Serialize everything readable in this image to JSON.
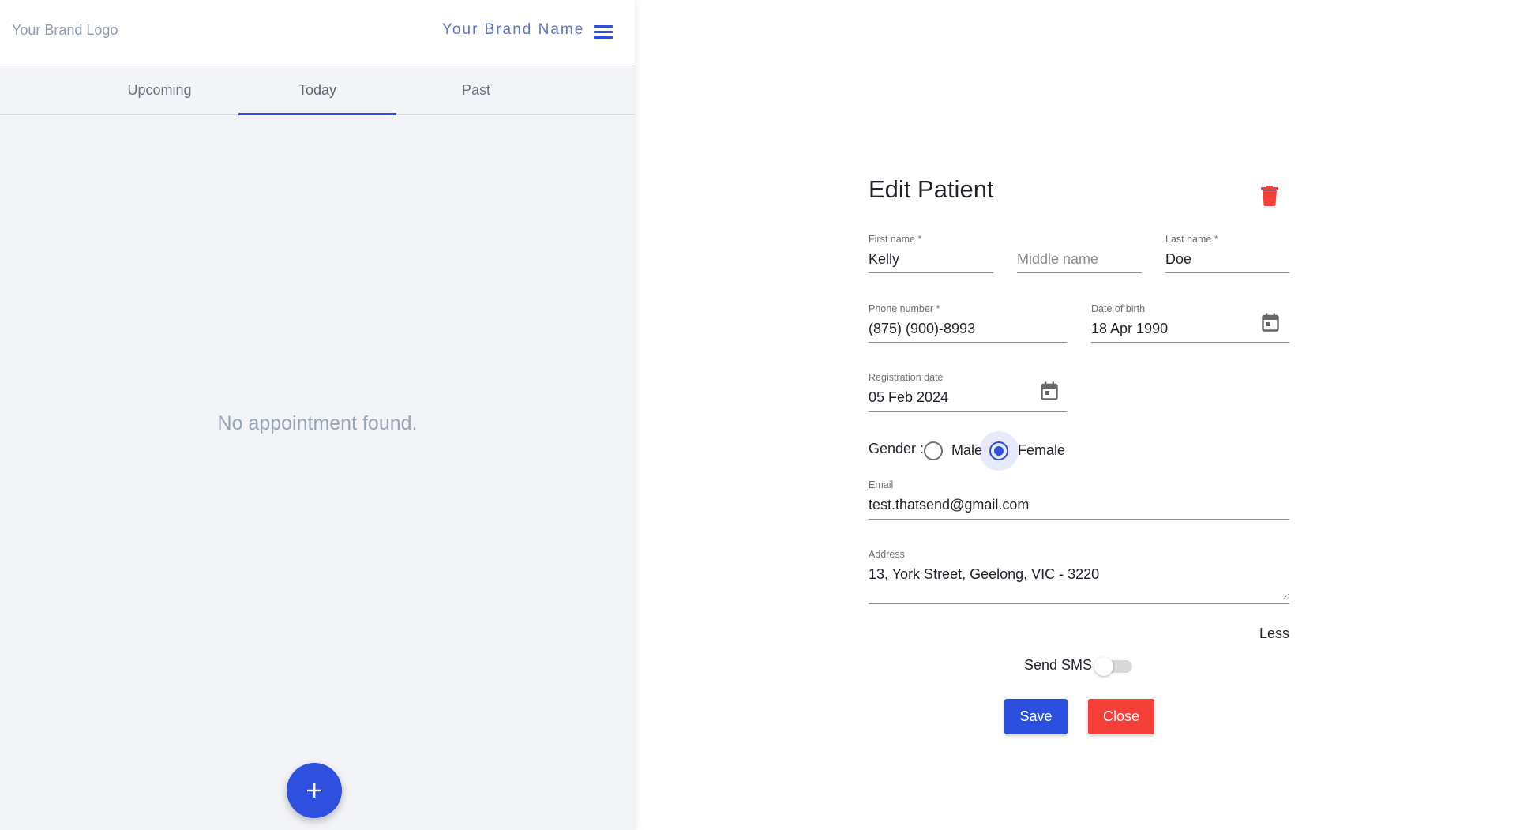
{
  "header": {
    "brand_logo": "Your Brand Logo",
    "brand_name": "Your Brand Name",
    "menu_icon": "hamburger-icon"
  },
  "tabs": [
    {
      "label": "Upcoming",
      "active": false
    },
    {
      "label": "Today",
      "active": true
    },
    {
      "label": "Past",
      "active": false
    }
  ],
  "appointments": {
    "empty_message": "No appointment found.",
    "fab_label": "+",
    "fab_icon": "plus-icon"
  },
  "form": {
    "title": "Edit Patient",
    "delete_icon": "trash-icon",
    "first_name": {
      "label": "First name *",
      "value": "Kelly"
    },
    "middle_name": {
      "placeholder": "Middle name",
      "value": ""
    },
    "last_name": {
      "label": "Last name *",
      "value": "Doe"
    },
    "phone": {
      "label": "Phone number *",
      "value": "(875) (900)-8993"
    },
    "dob": {
      "label": "Date of birth",
      "value": "18 Apr 1990",
      "icon": "calendar-icon"
    },
    "registration_date": {
      "label": "Registration date",
      "value": "05 Feb 2024",
      "icon": "calendar-icon"
    },
    "gender": {
      "label": "Gender :",
      "options": [
        {
          "label": "Male",
          "checked": false
        },
        {
          "label": "Female",
          "checked": true
        }
      ]
    },
    "email": {
      "label": "Email",
      "value": "test.thatsend@gmail.com"
    },
    "address": {
      "label": "Address",
      "value": "13, York Street, Geelong, VIC - 3220"
    },
    "less_link": "Less",
    "send_sms": {
      "label": "Send SMS",
      "enabled": false
    },
    "save_label": "Save",
    "close_label": "Close"
  },
  "colors": {
    "primary": "#2f4fdf",
    "danger": "#f5403a",
    "brand_text": "#5b73c9",
    "muted": "#97a3b6"
  }
}
